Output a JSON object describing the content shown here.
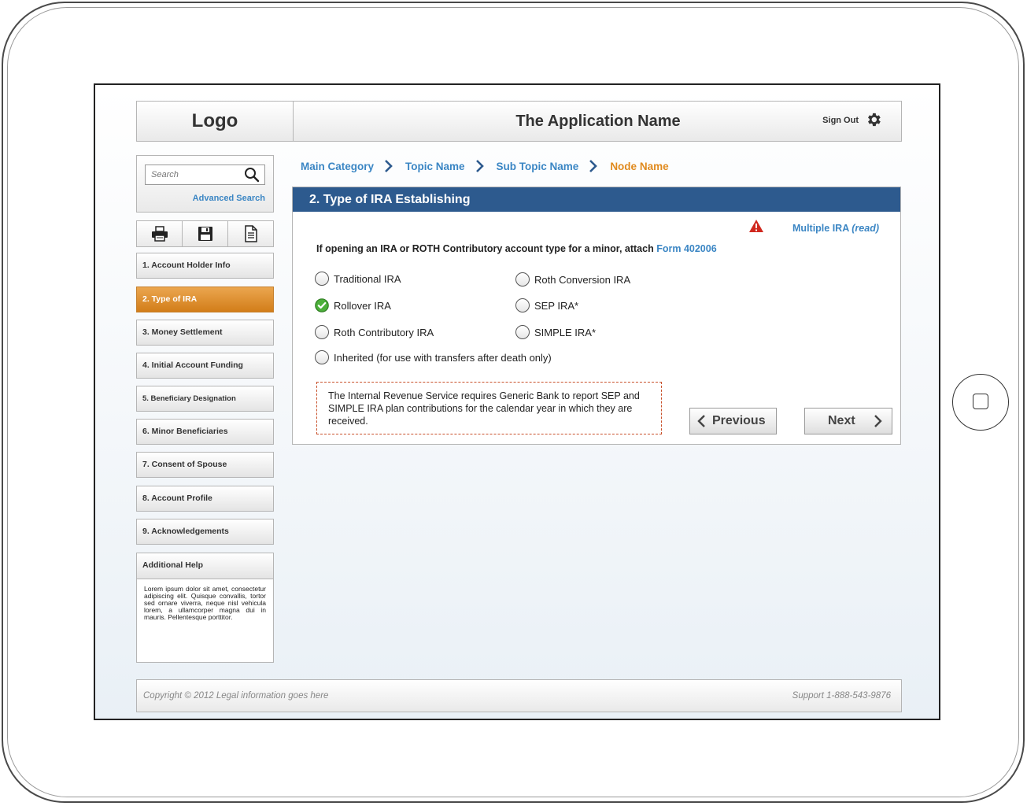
{
  "header": {
    "logo": "Logo",
    "app_name": "The Application Name",
    "sign_out": "Sign Out",
    "settings_icon": "gear-icon"
  },
  "sidebar": {
    "search": {
      "placeholder": "Search",
      "icon": "search-icon",
      "advanced_link": "Advanced Search"
    },
    "toolbar": {
      "icons": [
        "print-icon",
        "save-icon",
        "document-icon"
      ]
    },
    "steps": [
      {
        "label": "1. Account Holder Info",
        "active": false
      },
      {
        "label": "2. Type of IRA",
        "active": true
      },
      {
        "label": "3. Money Settlement",
        "active": false
      },
      {
        "label": "4. Initial Account Funding",
        "active": false
      },
      {
        "label": "5. Beneficiary Designation",
        "active": false
      },
      {
        "label": "6. Minor Beneficiaries",
        "active": false
      },
      {
        "label": "7. Consent of Spouse",
        "active": false
      },
      {
        "label": "8. Account Profile",
        "active": false
      },
      {
        "label": "9. Acknowledgements",
        "active": false
      }
    ],
    "help": {
      "title": "Additional Help",
      "text": "Lorem ipsum dolor sit amet, consectetur adipiscing elit. Quisque convallis, tortor sed ornare viverra, neque nisl vehicula lorem, a ullamcorper magna dui in mauris. Pellentesque porttitor."
    }
  },
  "breadcrumb": {
    "items": [
      "Main Category",
      "Topic Name",
      "Sub Topic Name",
      "Node Name"
    ]
  },
  "main": {
    "title": "2. Type of IRA Establishing",
    "multiple_ira_link": "Multiple IRA",
    "multiple_ira_suffix": "(read)",
    "instructions": "If opening an IRA or ROTH Contributory account type for a minor, attach",
    "form_link": "Form 402006",
    "options": [
      {
        "label": "Traditional IRA",
        "selected": false
      },
      {
        "label": "Roth Conversion IRA",
        "selected": false
      },
      {
        "label": "Rollover IRA",
        "selected": true
      },
      {
        "label": "SEP IRA*",
        "selected": false
      },
      {
        "label": "Roth Contributory IRA",
        "selected": false
      },
      {
        "label": "SIMPLE IRA*",
        "selected": false
      },
      {
        "label": "Inherited (for use with transfers after death only)",
        "selected": false
      }
    ],
    "notice": "The Internal Revenue Service requires Generic Bank to report SEP and SIMPLE IRA plan contributions for the calendar year in which they are received.",
    "previous_label": "Previous",
    "next_label": "Next"
  },
  "footer": {
    "copyright": "Copyright © 2012  Legal  information goes here",
    "support": "Support 1-888-543-9876"
  },
  "colors": {
    "header_blue": "#2d5a8e",
    "link_blue": "#3b86c4",
    "active_orange": "#e08a1e",
    "notice_border": "#c8502a",
    "warning_red": "#d0281e",
    "check_green": "#4caf3a"
  }
}
